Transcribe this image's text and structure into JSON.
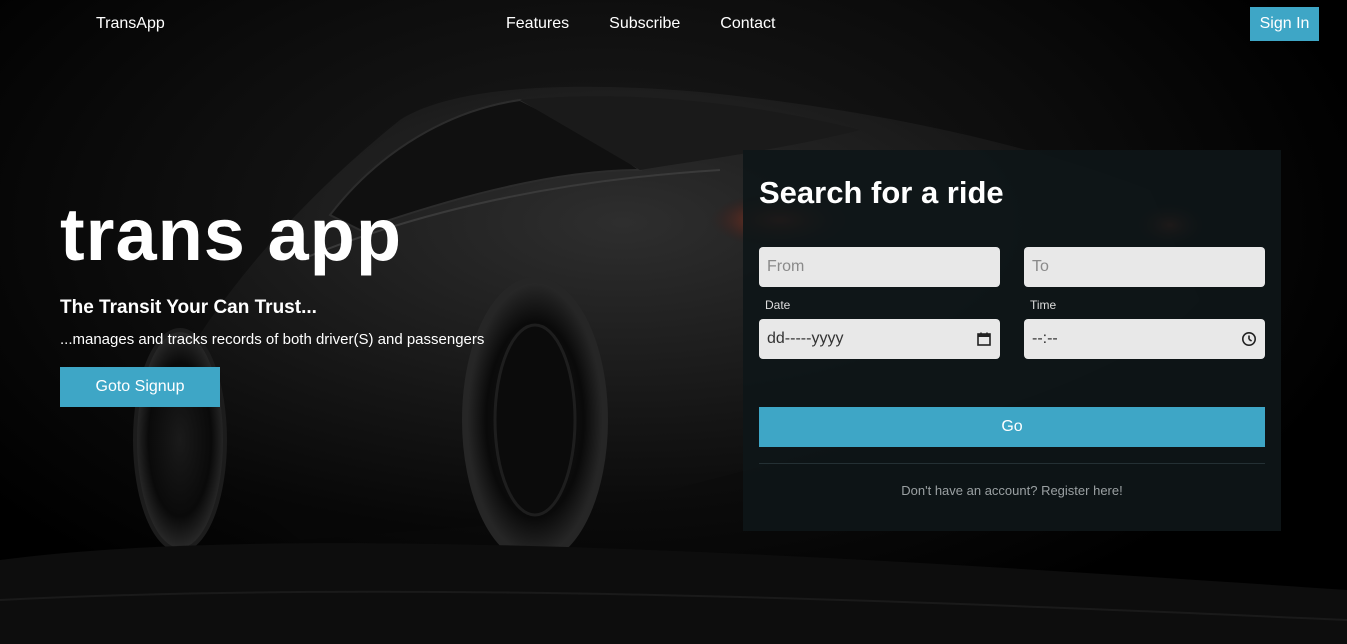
{
  "navbar": {
    "brand": "TransApp",
    "links": [
      "Features",
      "Subscribe",
      "Contact"
    ],
    "signin_label": "Sign In"
  },
  "hero": {
    "headline": "trans app",
    "subhead": "The Transit Your Can Trust...",
    "tagline": "...manages and tracks records of both driver(S) and passengers",
    "signup_label": "Goto Signup"
  },
  "search": {
    "title": "Search for a ride",
    "from_placeholder": "From",
    "to_placeholder": "To",
    "date_label": "Date",
    "date_value": "dd-----yyyy",
    "time_label": "Time",
    "time_value": "--:--",
    "go_label": "Go",
    "register_text": "Don't have an account? Register here!"
  },
  "colors": {
    "accent": "#3ea6c6",
    "card_bg": "#0e1618",
    "field_bg": "#e8e8e8"
  },
  "icons": {
    "date": "calendar-icon",
    "time": "clock-icon"
  }
}
